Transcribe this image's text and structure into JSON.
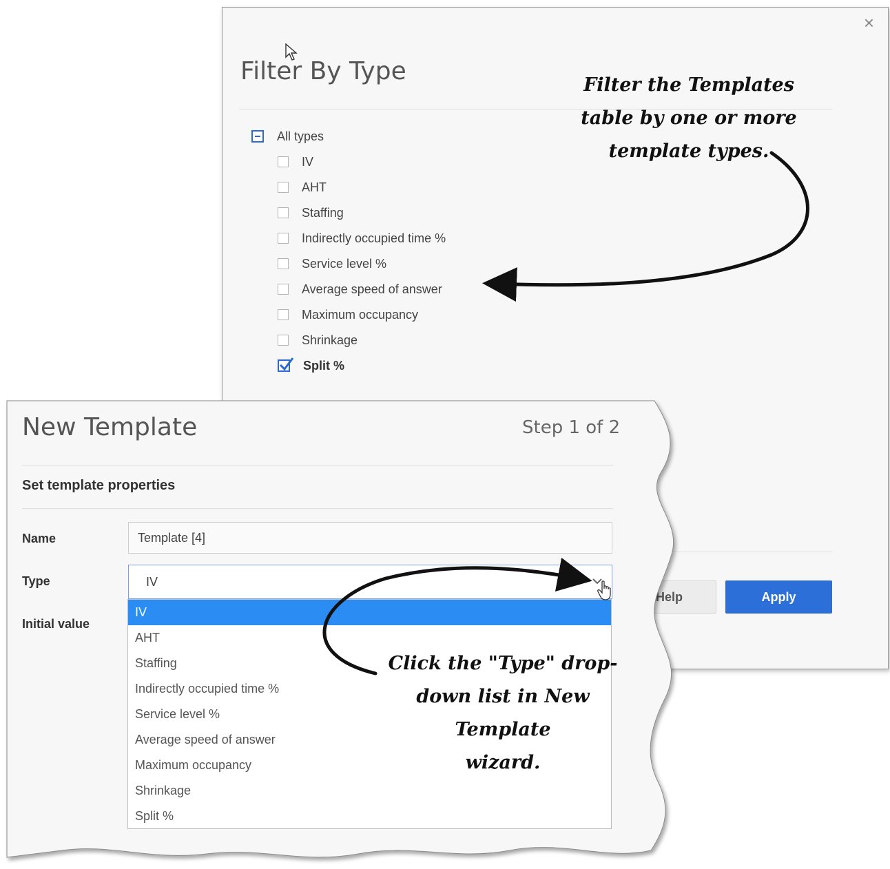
{
  "filter_dialog": {
    "title": "Filter By Type",
    "close_label": "×",
    "all_types_label": "All types",
    "items": [
      {
        "label": "IV",
        "checked": false
      },
      {
        "label": "AHT",
        "checked": false
      },
      {
        "label": "Staffing",
        "checked": false
      },
      {
        "label": "Indirectly occupied time %",
        "checked": false
      },
      {
        "label": "Service level %",
        "checked": false
      },
      {
        "label": "Average speed of answer",
        "checked": false
      },
      {
        "label": "Maximum occupancy",
        "checked": false
      },
      {
        "label": "Shrinkage",
        "checked": false
      },
      {
        "label": "Split %",
        "checked": true
      }
    ],
    "help_label": "Help",
    "apply_label": "Apply"
  },
  "wizard": {
    "title": "New Template",
    "step": "Step 1 of 2",
    "section": "Set template properties",
    "name_label": "Name",
    "name_value": "Template [4]",
    "type_label": "Type",
    "type_value": "IV",
    "initial_value_label": "Initial value",
    "type_options": [
      "IV",
      "AHT",
      "Staffing",
      "Indirectly occupied time %",
      "Service level %",
      "Average speed of answer",
      "Maximum occupancy",
      "Shrinkage",
      "Split %"
    ],
    "selected_option": "IV"
  },
  "annotations": {
    "filter_note": "Filter the Templates\ntable by one or more\ntemplate types.",
    "type_note": "Click the \"Type\" drop-\ndown list in New Template\nwizard."
  },
  "colors": {
    "accent": "#2d6fd8",
    "selected_option_bg": "#2b8df4"
  },
  "icons": {
    "close": "close-icon",
    "checkbox_checked": "checkmark-icon",
    "chevron": "chevron-down-icon",
    "cursor_arrow": "mouse-pointer-icon",
    "cursor_hand": "hand-pointer-icon"
  }
}
